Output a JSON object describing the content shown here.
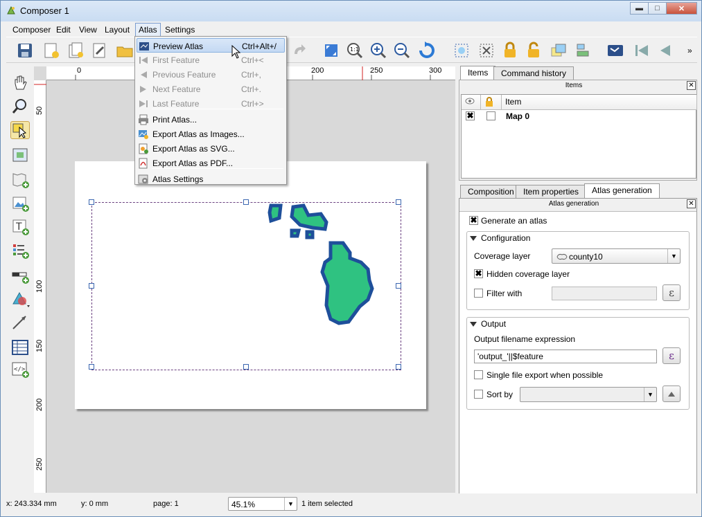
{
  "window": {
    "title": "Composer 1"
  },
  "menubar": [
    {
      "label": "Composer"
    },
    {
      "label": "Edit"
    },
    {
      "label": "View"
    },
    {
      "label": "Layout"
    },
    {
      "label": "Atlas"
    },
    {
      "label": "Settings"
    }
  ],
  "atlas_menu": {
    "items": [
      {
        "label": "Preview Atlas",
        "shortcut": "Ctrl+Alt+/",
        "enabled": true,
        "highlighted": true,
        "icon": "preview-atlas-icon"
      },
      {
        "label": "First Feature",
        "shortcut": "Ctrl+<",
        "enabled": false,
        "icon": "first-feature-icon"
      },
      {
        "label": "Previous Feature",
        "shortcut": "Ctrl+,",
        "enabled": false,
        "icon": "previous-feature-icon"
      },
      {
        "label": "Next Feature",
        "shortcut": "Ctrl+.",
        "enabled": false,
        "icon": "next-feature-icon"
      },
      {
        "label": "Last Feature",
        "shortcut": "Ctrl+>",
        "enabled": false,
        "icon": "last-feature-icon"
      },
      {
        "label": "Print Atlas...",
        "shortcut": "",
        "enabled": true,
        "icon": "print-icon"
      },
      {
        "label": "Export Atlas as Images...",
        "shortcut": "",
        "enabled": true,
        "icon": "export-images-icon"
      },
      {
        "label": "Export Atlas as SVG...",
        "shortcut": "",
        "enabled": true,
        "icon": "export-svg-icon"
      },
      {
        "label": "Export Atlas as PDF...",
        "shortcut": "",
        "enabled": true,
        "icon": "export-pdf-icon"
      },
      {
        "label": "Atlas Settings",
        "shortcut": "",
        "enabled": true,
        "icon": "atlas-settings-icon"
      }
    ]
  },
  "ruler": {
    "h_labels": [
      "0",
      "200",
      "250",
      "300"
    ],
    "v_labels": [
      "50",
      "100",
      "150",
      "200",
      "250"
    ]
  },
  "panel": {
    "top_tabs": [
      "Items",
      "Command history"
    ],
    "items_title": "Items",
    "item_header": "Item",
    "items": [
      {
        "name": "Map 0",
        "visible": true,
        "locked": false
      }
    ],
    "bottom_tabs": [
      "Composition",
      "Item properties",
      "Atlas generation"
    ],
    "atlas_title": "Atlas generation",
    "generate_label": "Generate an atlas",
    "generate_checked": true,
    "config_title": "Configuration",
    "coverage_label": "Coverage layer",
    "coverage_value": "county10",
    "hidden_label": "Hidden coverage layer",
    "hidden_checked": true,
    "filter_label": "Filter with",
    "filter_checked": false,
    "output_title": "Output",
    "filename_label": "Output filename expression",
    "filename_value": "'output_'||$feature",
    "single_label": "Single file export when possible",
    "single_checked": false,
    "sortby_label": "Sort by",
    "sortby_checked": false,
    "expr_button": "ε"
  },
  "statusbar": {
    "x": "x: 243.334 mm",
    "y": "y: 0 mm",
    "page": "page: 1",
    "zoom": "45.1%",
    "selection": "1 item selected"
  },
  "colors": {
    "island_fill": "#2fc281",
    "island_border": "#1e4f9a",
    "accent": "#3a66b0"
  }
}
